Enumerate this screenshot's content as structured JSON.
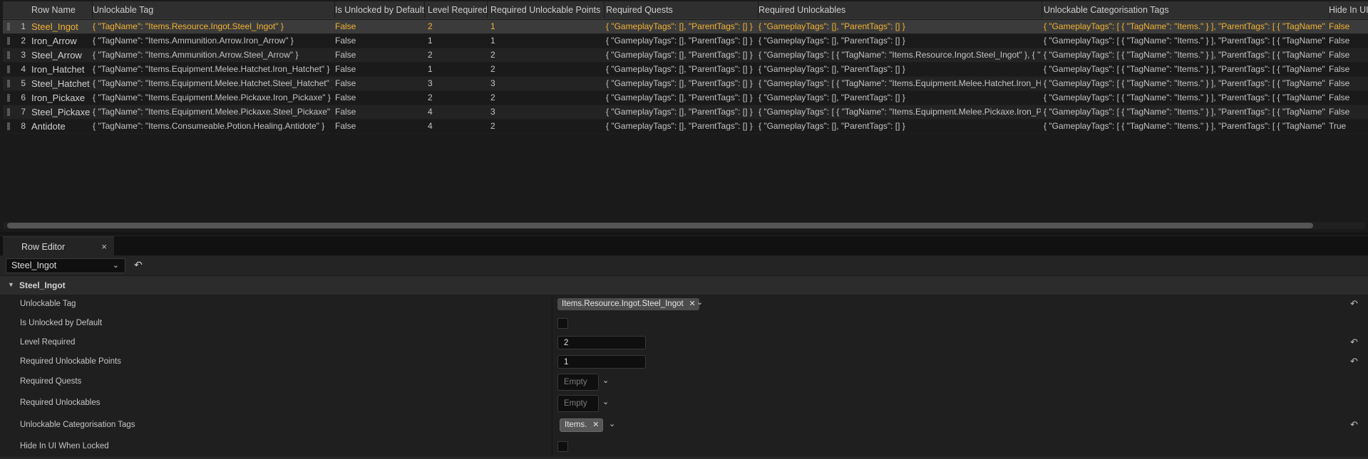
{
  "table": {
    "columns": [
      "Row Name",
      "Unlockable Tag",
      "Is Unlocked by Default",
      "Level Required",
      "Required Unlockable Points",
      "Required Quests",
      "Required Unlockables",
      "Unlockable Categorisation Tags",
      "Hide In UI When Locked"
    ],
    "rows": [
      {
        "num": "1",
        "name": "Steel_Ingot",
        "tag": "{ \"TagName\": \"Items.Resource.Ingot.Steel_Ingot\" }",
        "def": "False",
        "level": "2",
        "points": "1",
        "quests": "{ \"GameplayTags\": [], \"ParentTags\": [] }",
        "unlockables": "{ \"GameplayTags\": [], \"ParentTags\": [] }",
        "cats": "{ \"GameplayTags\": [ { \"TagName\": \"Items.\" } ], \"ParentTags\": [ { \"TagName\": \"Items.\" } ] }",
        "hide": "False"
      },
      {
        "num": "2",
        "name": "Iron_Arrow",
        "tag": "{ \"TagName\": \"Items.Ammunition.Arrow.Iron_Arrow\" }",
        "def": "False",
        "level": "1",
        "points": "1",
        "quests": "{ \"GameplayTags\": [], \"ParentTags\": [] }",
        "unlockables": "{ \"GameplayTags\": [], \"ParentTags\": [] }",
        "cats": "{ \"GameplayTags\": [ { \"TagName\": \"Items.\" } ], \"ParentTags\": [ { \"TagName\": \"Items.\" } ] }",
        "hide": "False"
      },
      {
        "num": "3",
        "name": "Steel_Arrow",
        "tag": "{ \"TagName\": \"Items.Ammunition.Arrow.Steel_Arrow\" }",
        "def": "False",
        "level": "2",
        "points": "2",
        "quests": "{ \"GameplayTags\": [], \"ParentTags\": [] }",
        "unlockables": "{ \"GameplayTags\": [ { \"TagName\": \"Items.Resource.Ingot.Steel_Ingot\" }, { \"TagName\": \"Items.Ammunition.Arrow.Iron_Arrow\" } ] }",
        "cats": "{ \"GameplayTags\": [ { \"TagName\": \"Items.\" } ], \"ParentTags\": [ { \"TagName\": \"Items.\" } ] }",
        "hide": "False"
      },
      {
        "num": "4",
        "name": "Iron_Hatchet",
        "tag": "{ \"TagName\": \"Items.Equipment.Melee.Hatchet.Iron_Hatchet\" }",
        "def": "False",
        "level": "1",
        "points": "2",
        "quests": "{ \"GameplayTags\": [], \"ParentTags\": [] }",
        "unlockables": "{ \"GameplayTags\": [], \"ParentTags\": [] }",
        "cats": "{ \"GameplayTags\": [ { \"TagName\": \"Items.\" } ], \"ParentTags\": [ { \"TagName\": \"Items.\" } ] }",
        "hide": "False"
      },
      {
        "num": "5",
        "name": "Steel_Hatchet",
        "tag": "{ \"TagName\": \"Items.Equipment.Melee.Hatchet.Steel_Hatchet\" }",
        "def": "False",
        "level": "3",
        "points": "3",
        "quests": "{ \"GameplayTags\": [], \"ParentTags\": [] }",
        "unlockables": "{ \"GameplayTags\": [ { \"TagName\": \"Items.Equipment.Melee.Hatchet.Iron_Hatchet\" } ] }",
        "cats": "{ \"GameplayTags\": [ { \"TagName\": \"Items.\" } ], \"ParentTags\": [ { \"TagName\": \"Items.\" } ] }",
        "hide": "False"
      },
      {
        "num": "6",
        "name": "Iron_Pickaxe",
        "tag": "{ \"TagName\": \"Items.Equipment.Melee.Pickaxe.Iron_Pickaxe\" }",
        "def": "False",
        "level": "2",
        "points": "2",
        "quests": "{ \"GameplayTags\": [], \"ParentTags\": [] }",
        "unlockables": "{ \"GameplayTags\": [], \"ParentTags\": [] }",
        "cats": "{ \"GameplayTags\": [ { \"TagName\": \"Items.\" } ], \"ParentTags\": [ { \"TagName\": \"Items.\" } ] }",
        "hide": "False"
      },
      {
        "num": "7",
        "name": "Steel_Pickaxe",
        "tag": "{ \"TagName\": \"Items.Equipment.Melee.Pickaxe.Steel_Pickaxe\" }",
        "def": "False",
        "level": "4",
        "points": "3",
        "quests": "{ \"GameplayTags\": [], \"ParentTags\": [] }",
        "unlockables": "{ \"GameplayTags\": [ { \"TagName\": \"Items.Equipment.Melee.Pickaxe.Iron_Pickaxe\" } ] }",
        "cats": "{ \"GameplayTags\": [ { \"TagName\": \"Items.\" } ], \"ParentTags\": [ { \"TagName\": \"Items.\" } ] }",
        "hide": "False"
      },
      {
        "num": "8",
        "name": "Antidote",
        "tag": "{ \"TagName\": \"Items.Consumeable.Potion.Healing.Antidote\" }",
        "def": "False",
        "level": "4",
        "points": "2",
        "quests": "{ \"GameplayTags\": [], \"ParentTags\": [] }",
        "unlockables": "{ \"GameplayTags\": [], \"ParentTags\": [] }",
        "cats": "{ \"GameplayTags\": [ { \"TagName\": \"Items.\" } ], \"ParentTags\": [ { \"TagName\": \"Items.\" } ] }",
        "hide": "True"
      }
    ]
  },
  "tab": {
    "label": "Row Editor",
    "close": "×"
  },
  "toolbar": {
    "selected_row": "Steel_Ingot",
    "chevron": "⌄",
    "undo": "↶"
  },
  "editor": {
    "section_title": "Steel_Ingot",
    "section_arrow": "▼",
    "reset_icon": "↶",
    "properties": {
      "unlockable_tag_label": "Unlockable Tag",
      "unlockable_tag_value": "Items.Resource.Ingot.Steel_Ingot",
      "is_unlocked_label": "Is Unlocked by Default",
      "level_label": "Level Required",
      "level_value": "2",
      "points_label": "Required Unlockable Points",
      "points_value": "1",
      "quests_label": "Required Quests",
      "quests_value": "Empty",
      "unlockables_label": "Required Unlockables",
      "unlockables_value": "Empty",
      "cats_label": "Unlockable Categorisation Tags",
      "cats_value": "Items.",
      "hide_label": "Hide In UI When Locked"
    },
    "chip_remove": "✕",
    "chevron": "⌄"
  }
}
